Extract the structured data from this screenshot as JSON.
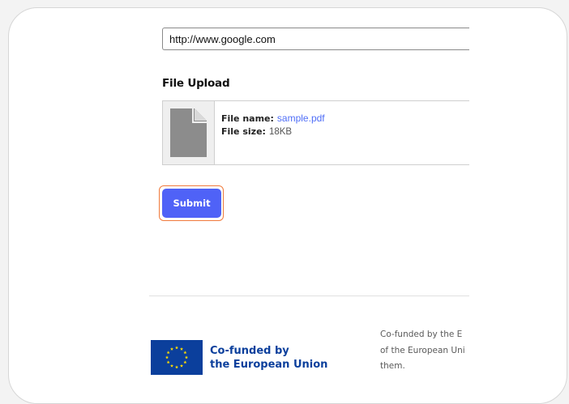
{
  "url_field": {
    "value": "http://www.google.com"
  },
  "file_upload": {
    "title": "File Upload",
    "file_name_label": "File name:",
    "file_name_value": "sample.pdf",
    "file_size_label": "File size:",
    "file_size_value": "18KB"
  },
  "submit": {
    "label": "Submit"
  },
  "footer": {
    "eu_line1": "Co-funded by",
    "eu_line2": "the European Union",
    "disclaimer_line1": "Co-funded by the E",
    "disclaimer_line2": "of the European Uni",
    "disclaimer_line3": "them."
  },
  "colors": {
    "accent": "#4f62f7",
    "highlight": "#f07a3c",
    "eu_blue": "#0b3f9c",
    "eu_star": "#ffdd00",
    "link": "#4f6ef7"
  },
  "icons": {
    "file": "file-icon",
    "eu_flag": "eu-flag-icon"
  }
}
